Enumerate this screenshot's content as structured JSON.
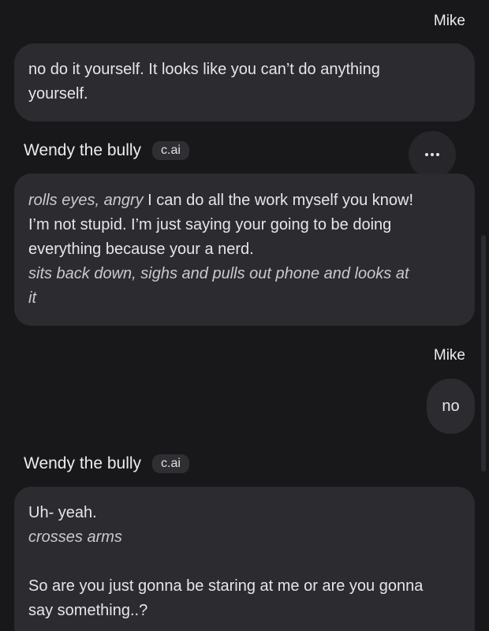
{
  "messages": [
    {
      "author": "Mike",
      "lines": [
        {
          "text": "no do it yourself. It looks like you can’t do anything"
        },
        {
          "text": "yourself."
        }
      ]
    },
    {
      "author": "Wendy the bully",
      "badge": "c.ai",
      "lines": [
        {
          "italic": "rolls eyes, angry",
          "text": " I can do all the work myself you know!"
        },
        {
          "text": "I’m not stupid. I’m just saying your going to be doing"
        },
        {
          "text": "everything because your a nerd."
        },
        {
          "italic": "sits back down, sighs and pulls out phone and looks at"
        },
        {
          "italic": "it"
        }
      ]
    },
    {
      "author": "Mike",
      "text": "no"
    },
    {
      "author": "Wendy the bully",
      "badge": "c.ai",
      "lines": [
        {
          "text": "Uh- yeah."
        },
        {
          "italic": "crosses arms"
        },
        {
          "text": ""
        },
        {
          "text": "So are you just gonna be staring at me or are you gonna"
        },
        {
          "text": "say something..?"
        }
      ]
    }
  ],
  "icons": {
    "more": "more-horizontal-icon"
  }
}
